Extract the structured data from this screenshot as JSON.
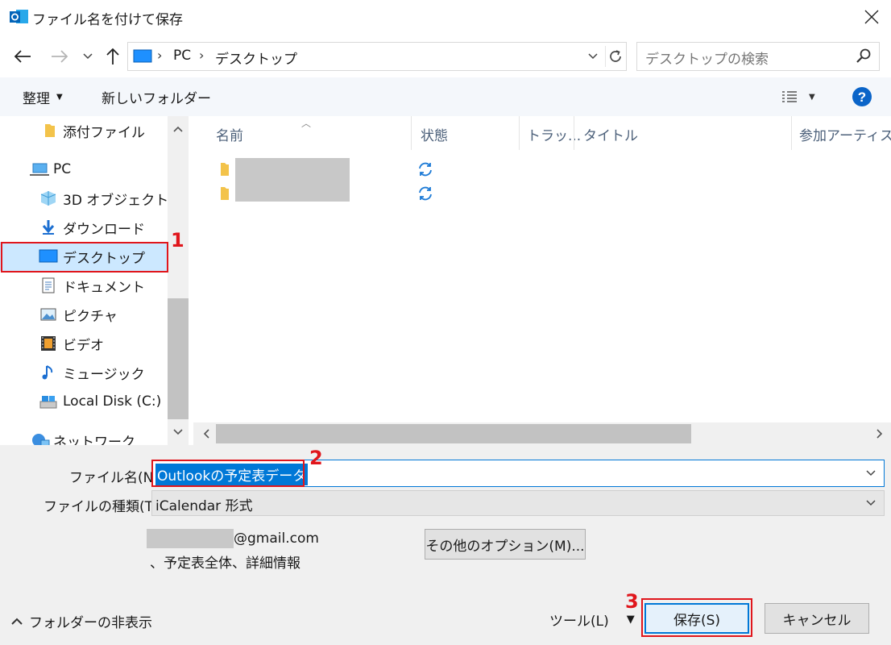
{
  "window": {
    "title": "ファイル名を付けて保存",
    "accent_color": "#0078d7",
    "highlight_color": "#e0161c"
  },
  "address": {
    "segments": [
      "PC",
      "デスクトップ"
    ],
    "search_placeholder": "デスクトップの検索"
  },
  "toolbar": {
    "organize_label": "整理",
    "new_folder_label": "新しいフォルダー"
  },
  "nav": {
    "items": [
      {
        "label": "添付ファイル",
        "icon": "folder-icon"
      },
      {
        "label": "PC",
        "icon": "computer-icon"
      },
      {
        "label": "3D オブジェクト",
        "icon": "3d-objects-icon"
      },
      {
        "label": "ダウンロード",
        "icon": "download-icon"
      },
      {
        "label": "デスクトップ",
        "icon": "desktop-icon",
        "selected": true
      },
      {
        "label": "ドキュメント",
        "icon": "document-icon"
      },
      {
        "label": "ピクチャ",
        "icon": "picture-icon"
      },
      {
        "label": "ビデオ",
        "icon": "video-icon"
      },
      {
        "label": "ミュージック",
        "icon": "music-icon"
      },
      {
        "label": "Local Disk (C:)",
        "icon": "disk-icon"
      },
      {
        "label": "ネットワーク",
        "icon": "network-icon"
      }
    ]
  },
  "file_list": {
    "columns": [
      "名前",
      "状態",
      "トラッ...",
      "タイトル",
      "参加アーティスト"
    ]
  },
  "form": {
    "filename_label": "ファイル名(N):",
    "filename_value": "Outlookの予定表データ",
    "filetype_label": "ファイルの種類(T):",
    "filetype_value": "iCalendar 形式",
    "account_email": "@gmail.com",
    "account_detail": "、予定表全体、詳細情報",
    "options_label": "その他のオプション(M)..."
  },
  "footer": {
    "hide_folders_label": "フォルダーの非表示",
    "tools_label": "ツール(L)",
    "save_label": "保存(S)",
    "cancel_label": "キャンセル"
  },
  "steps": [
    "1",
    "2",
    "3"
  ]
}
